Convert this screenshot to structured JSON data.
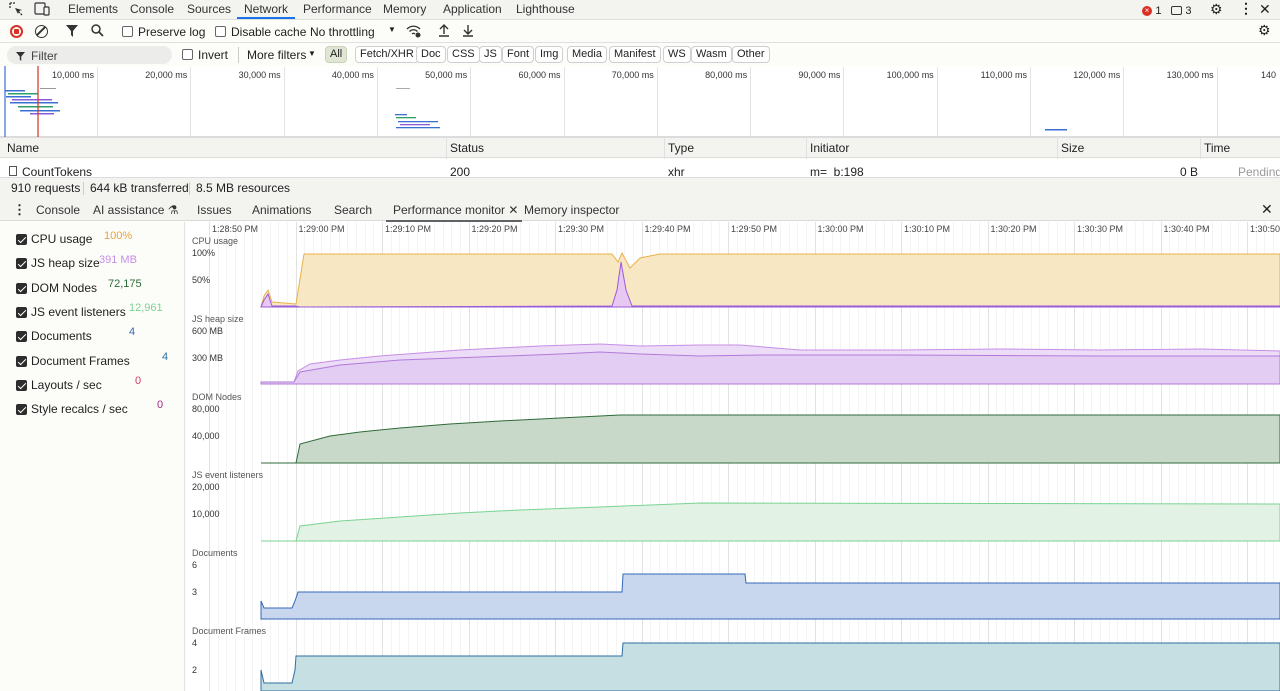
{
  "main_tabs": [
    "Elements",
    "Console",
    "Sources",
    "Network",
    "Performance",
    "Memory",
    "Application",
    "Lighthouse"
  ],
  "active_main_tab": "Network",
  "status": {
    "errors": "1",
    "messages": "3"
  },
  "network_toolbar": {
    "preserve_log": "Preserve log",
    "disable_cache": "Disable cache",
    "throttling": "No throttling"
  },
  "filter_bar": {
    "filter_placeholder": "Filter",
    "invert": "Invert",
    "more_filters": "More filters",
    "types": [
      "All",
      "Fetch/XHR",
      "Doc",
      "CSS",
      "JS",
      "Font",
      "Img",
      "Media",
      "Manifest",
      "WS",
      "Wasm",
      "Other"
    ]
  },
  "overview_ticks": [
    "10,000 ms",
    "20,000 ms",
    "30,000 ms",
    "40,000 ms",
    "50,000 ms",
    "60,000 ms",
    "70,000 ms",
    "80,000 ms",
    "90,000 ms",
    "100,000 ms",
    "110,000 ms",
    "120,000 ms",
    "130,000 ms",
    "140"
  ],
  "table": {
    "columns": [
      "Name",
      "Status",
      "Type",
      "Initiator",
      "Size",
      "Time"
    ],
    "row": {
      "name": "CountTokens",
      "status": "200",
      "type": "xhr",
      "initiator": "m=_b:198",
      "size": "0 B",
      "time": "Pending"
    }
  },
  "summary": {
    "requests": "910 requests",
    "transferred": "644 kB transferred",
    "resources": "8.5 MB resources"
  },
  "drawer_tabs": [
    "Console",
    "AI assistance",
    "Issues",
    "Animations",
    "Search",
    "Performance monitor",
    "Memory inspector"
  ],
  "active_drawer_tab": "Performance monitor",
  "metrics": [
    {
      "label": "CPU usage",
      "value": "100%",
      "color": "#e8a33c"
    },
    {
      "label": "JS heap size",
      "value": "391 MB",
      "color": "#c78ee6"
    },
    {
      "label": "DOM Nodes",
      "value": "72,175",
      "color": "#2e6b3a"
    },
    {
      "label": "JS event listeners",
      "value": "12,961",
      "color": "#7ad393"
    },
    {
      "label": "Documents",
      "value": "4",
      "color": "#3468b8"
    },
    {
      "label": "Document Frames",
      "value": "4",
      "color": "#2f6fa3"
    },
    {
      "label": "Layouts / sec",
      "value": "0",
      "color": "#d23b6b"
    },
    {
      "label": "Style recalcs / sec",
      "value": "0",
      "color": "#9c2a8a"
    }
  ],
  "time_labels": [
    "1:28:50 PM",
    "1:29:00 PM",
    "1:29:10 PM",
    "1:29:20 PM",
    "1:29:30 PM",
    "1:29:40 PM",
    "1:29:50 PM",
    "1:30:00 PM",
    "1:30:10 PM",
    "1:30:20 PM",
    "1:30:30 PM",
    "1:30:40 PM",
    "1:30:50"
  ],
  "charts": {
    "cpu": {
      "name": "CPU usage",
      "ticks": [
        "100%",
        "50%"
      ]
    },
    "heap": {
      "name": "JS heap size",
      "ticks": [
        "600 MB",
        "300 MB"
      ]
    },
    "dom": {
      "name": "DOM Nodes",
      "ticks": [
        "80,000",
        "40,000"
      ]
    },
    "listeners": {
      "name": "JS event listeners",
      "ticks": [
        "20,000",
        "10,000"
      ]
    },
    "documents": {
      "name": "Documents",
      "ticks": [
        "6",
        "3"
      ]
    },
    "frames": {
      "name": "Document Frames",
      "ticks": [
        "4",
        "2"
      ]
    }
  }
}
